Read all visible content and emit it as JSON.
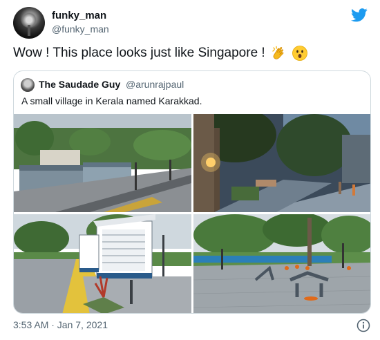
{
  "author": {
    "display_name": "funky_man",
    "handle": "@funky_man"
  },
  "tweet": {
    "text": "Wow ! This place looks just like Singapore !",
    "emojis": [
      "clapping-hands-emoji",
      "astonished-face-emoji"
    ],
    "timestamp": "3:53 AM · Jan 7, 2021"
  },
  "quoted_tweet": {
    "display_name": "The Saudade Guy",
    "handle": "@arunrajpaul",
    "text": "A small village in Kerala named Karakkad.",
    "photo_count": 4
  },
  "icons": {
    "brand": "twitter-bird-icon",
    "info": "info-icon"
  },
  "colors": {
    "twitter_blue": "#1d9bf0",
    "secondary_text": "#536471",
    "border": "#cfd9de"
  }
}
